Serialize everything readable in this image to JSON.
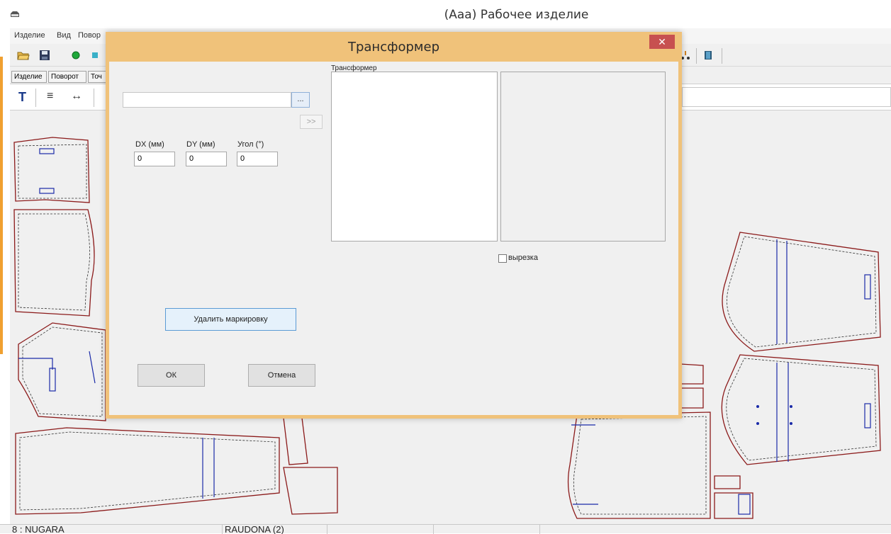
{
  "window": {
    "title": "(Aaa) Рабочее изделие"
  },
  "menu": {
    "items": [
      "Изделие",
      "Вид",
      "Повор"
    ]
  },
  "tabs": [
    "Изделие",
    "Поворот",
    "Точ"
  ],
  "toolbar2": {
    "text_tool": "T",
    "align_tool": "≡",
    "arrows_tool": "↔"
  },
  "dialog": {
    "title": "Трансформер",
    "close_label": "✕",
    "browse_label": "...",
    "forward_label": ">>",
    "file_value": "",
    "dx_label": "DX (мм)",
    "dy_label": "DY (мм)",
    "angle_label": "Угол (°)",
    "dx_value": "0",
    "dy_value": "0",
    "angle_value": "0",
    "group_label": "Трансформер",
    "checkbox_label": "вырезка",
    "checkbox_checked": false,
    "delete_marking_label": "Удалить маркировку",
    "ok_label": "ОК",
    "cancel_label": "Отмена"
  },
  "statusbar": {
    "cells": [
      "8 : NUGARA",
      "RAUDONA (2)",
      "",
      "",
      "",
      ""
    ]
  },
  "colors": {
    "dialog_frame": "#f0c27a",
    "close_button": "#c75050",
    "pattern_outline": "#8b1a1a",
    "grainline": "#1a2aa8"
  },
  "icons": [
    "app-icon",
    "open-folder-icon",
    "save-icon",
    "green-circle-icon",
    "shape-icon",
    "tool-icon",
    "book-icon",
    "text-tool-icon",
    "align-icon",
    "arrows-icon",
    "close-icon"
  ]
}
